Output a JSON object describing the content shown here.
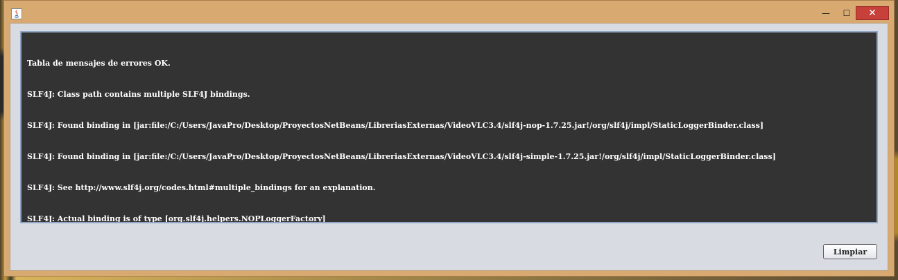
{
  "window": {
    "app_icon": "java-icon",
    "controls": {
      "minimize_glyph": "—",
      "maximize_glyph": "☐",
      "close_glyph": "✕"
    }
  },
  "console": {
    "lines": [
      "Tabla de mensajes de errores OK.",
      "SLF4J: Class path contains multiple SLF4J bindings.",
      "SLF4J: Found binding in [jar:file:/C:/Users/JavaPro/Desktop/ProyectosNetBeans/LibreriasExternas/VideoVLC3.4/slf4j-nop-1.7.25.jar!/org/slf4j/impl/StaticLoggerBinder.class]",
      "SLF4J: Found binding in [jar:file:/C:/Users/JavaPro/Desktop/ProyectosNetBeans/LibreriasExternas/VideoVLC3.4/slf4j-simple-1.7.25.jar!/org/slf4j/impl/StaticLoggerBinder.class]",
      "SLF4J: See http://www.slf4j.org/codes.html#multiple_bindings for an explanation.",
      "SLF4J: Actual binding is of type [org.slf4j.helpers.NOPLoggerFactory]"
    ]
  },
  "actions": {
    "clear_label": "Limpiar"
  },
  "colors": {
    "window_frame": "#d8aa72",
    "client_bg": "#d9dbe3",
    "console_bg": "#333333",
    "console_text": "#ffffff",
    "close_button": "#c7403a"
  }
}
